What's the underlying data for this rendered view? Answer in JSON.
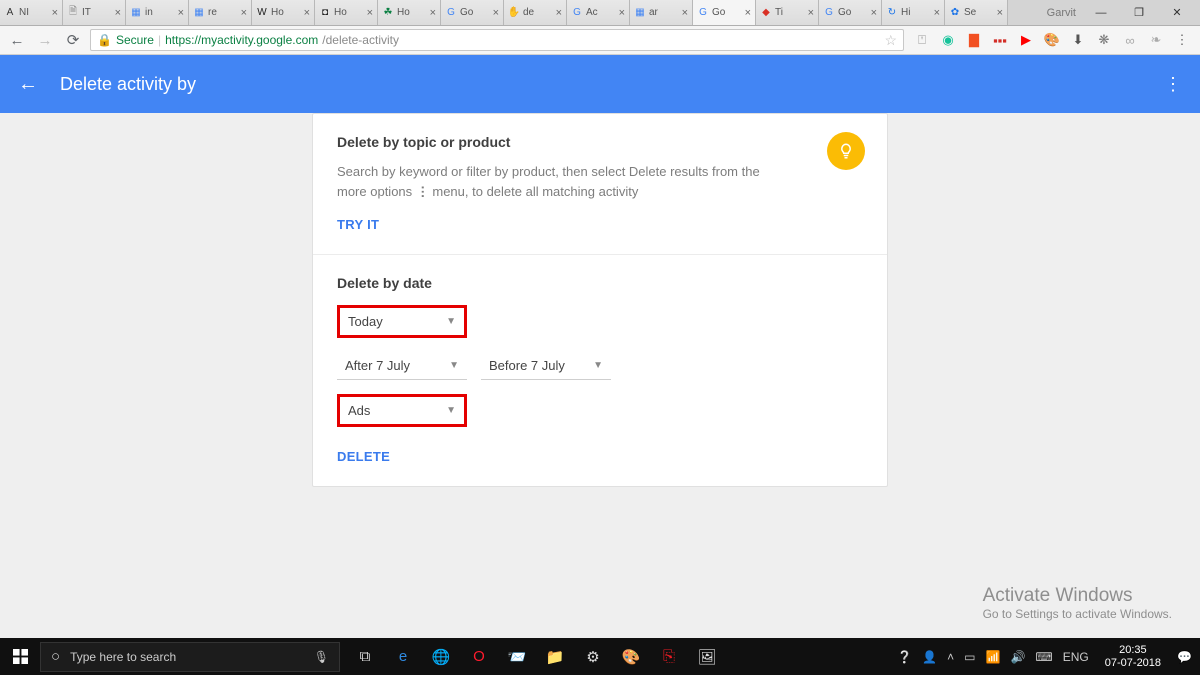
{
  "browser": {
    "tabs": [
      {
        "favicon": "A",
        "title": "NI",
        "color": "#333"
      },
      {
        "favicon": "🗎",
        "title": "IT",
        "color": "#888"
      },
      {
        "favicon": "▦",
        "title": "in",
        "color": "#4285f4"
      },
      {
        "favicon": "▦",
        "title": "re",
        "color": "#4285f4"
      },
      {
        "favicon": "W",
        "title": "Ho",
        "color": "#222"
      },
      {
        "favicon": "◘",
        "title": "Ho",
        "color": "#222"
      },
      {
        "favicon": "☘",
        "title": "Ho",
        "color": "#0b8043"
      },
      {
        "favicon": "G",
        "title": "Go",
        "color": "#4285f4"
      },
      {
        "favicon": "✋",
        "title": "de",
        "color": "#f5a623"
      },
      {
        "favicon": "G",
        "title": "Ac",
        "color": "#4285f4"
      },
      {
        "favicon": "▦",
        "title": "ar",
        "color": "#4285f4"
      },
      {
        "favicon": "G",
        "title": "Go",
        "color": "#4285f4",
        "active": true
      },
      {
        "favicon": "◆",
        "title": "Ti",
        "color": "#d93025"
      },
      {
        "favicon": "G",
        "title": "Go",
        "color": "#4285f4"
      },
      {
        "favicon": "↻",
        "title": "Hi",
        "color": "#1a73e8"
      },
      {
        "favicon": "✿",
        "title": "Se",
        "color": "#1a73e8"
      }
    ],
    "profile": "Garvit",
    "secure_label": "Secure",
    "url_host": "https://myactivity.google.com",
    "url_path": "/delete-activity"
  },
  "page": {
    "header_title": "Delete activity by",
    "section1": {
      "title": "Delete by topic or product",
      "desc_before": "Search by keyword or filter by product, then select Delete results from the more options ",
      "desc_after": " menu, to delete all matching activity",
      "try_it": "TRY IT"
    },
    "section2": {
      "title": "Delete by date",
      "date_select": "Today",
      "after_label": "After 7 July",
      "before_label": "Before 7 July",
      "product_select": "Ads",
      "delete_btn": "DELETE"
    }
  },
  "watermark": {
    "title": "Activate Windows",
    "sub": "Go to Settings to activate Windows."
  },
  "taskbar": {
    "search_placeholder": "Type here to search",
    "lang": "ENG",
    "time": "20:35",
    "date": "07-07-2018"
  }
}
